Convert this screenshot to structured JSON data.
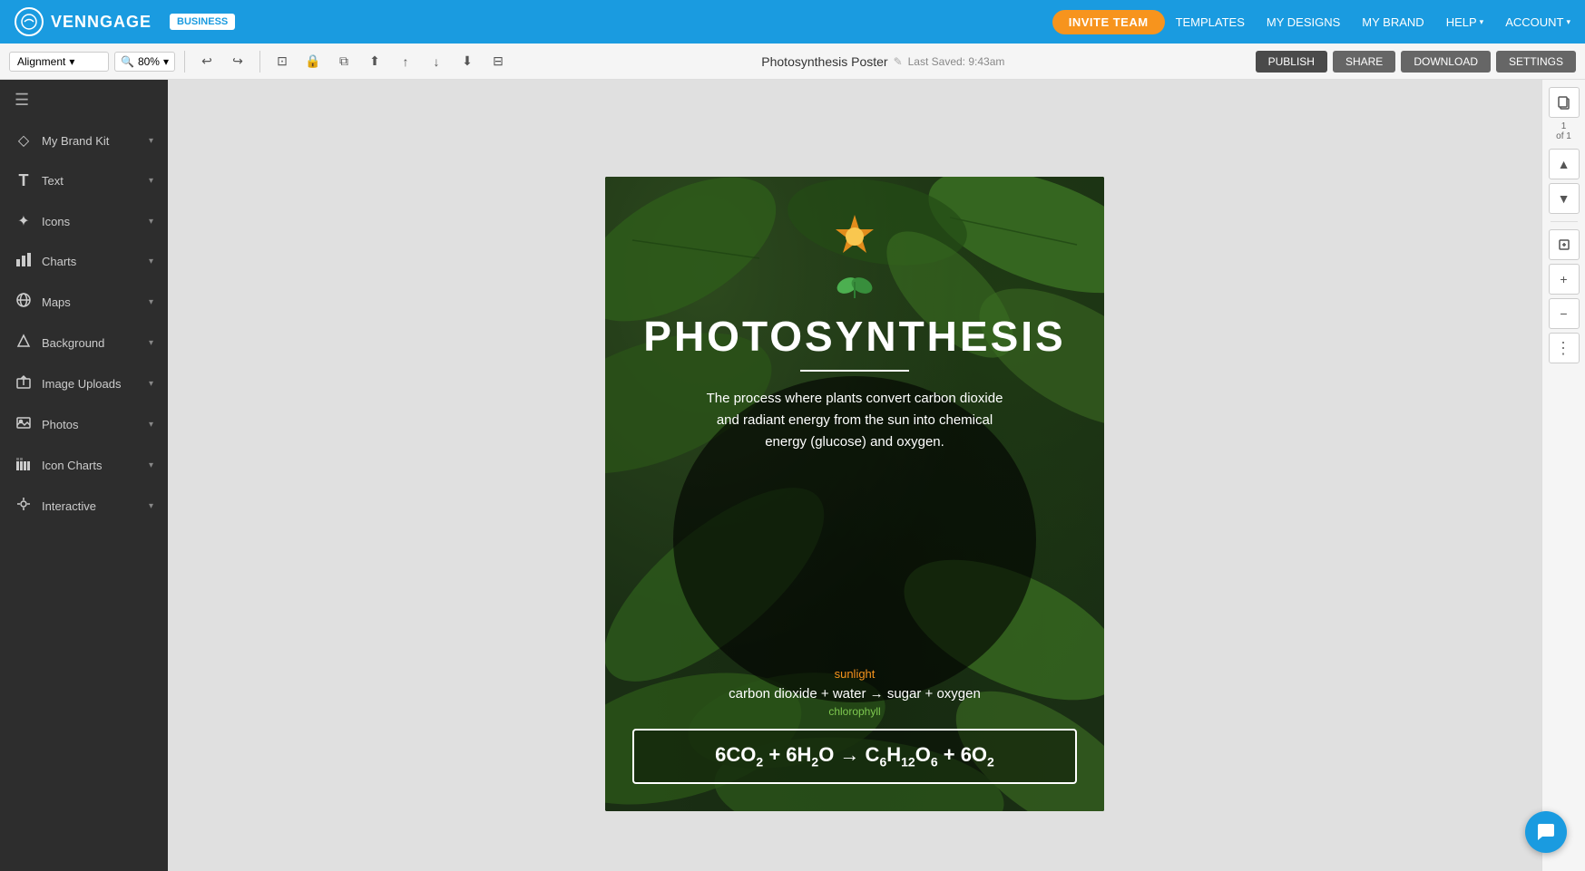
{
  "brand": "VENNGAGE",
  "badge": "BUSINESS",
  "nav": {
    "invite_btn": "INVITE TEAM",
    "links": [
      {
        "label": "TEMPLATES",
        "has_dropdown": false
      },
      {
        "label": "MY DESIGNS",
        "has_dropdown": false
      },
      {
        "label": "MY BRAND",
        "has_dropdown": false
      },
      {
        "label": "HELP",
        "has_dropdown": true
      },
      {
        "label": "ACCOUNT",
        "has_dropdown": true
      }
    ]
  },
  "toolbar": {
    "alignment_label": "Alignment",
    "zoom_label": "80%",
    "doc_title": "Photosynthesis Poster",
    "save_status": "Last Saved: 9:43am",
    "undo_icon": "↩",
    "redo_icon": "↪",
    "publish_label": "PUBLISH",
    "share_label": "SHARE",
    "download_label": "DOWNLOAD",
    "settings_label": "SETTINGS"
  },
  "sidebar": {
    "items": [
      {
        "label": "My Brand Kit",
        "icon": "◇"
      },
      {
        "label": "Text",
        "icon": "T"
      },
      {
        "label": "Icons",
        "icon": "❖"
      },
      {
        "label": "Charts",
        "icon": "📊"
      },
      {
        "label": "Maps",
        "icon": "🌐"
      },
      {
        "label": "Background",
        "icon": "□"
      },
      {
        "label": "Image Uploads",
        "icon": "⬆"
      },
      {
        "label": "Photos",
        "icon": "🖼"
      },
      {
        "label": "Icon Charts",
        "icon": "📈"
      },
      {
        "label": "Interactive",
        "icon": "⚡"
      }
    ]
  },
  "poster": {
    "sun_icon": "✦",
    "plant_icon": "🌿",
    "title": "PHOTOSYNTHESIS",
    "description": "The process where plants convert carbon dioxide and radiant energy from the sun into chemical energy (glucose) and oxygen.",
    "sunlight_label": "sunlight",
    "simple_equation": "carbon dioxide + water → sugar + oxygen",
    "chlorophyll_label": "chlorophyll",
    "equation": "6CO₂ + 6H₂O → C₆H₁₂O₆ + 6O₂"
  },
  "right_panel": {
    "page_num": "1",
    "page_total": "of 1"
  },
  "colors": {
    "nav_blue": "#1a9be0",
    "orange": "#f7941d",
    "green": "#4caf50",
    "dark_bg": "#2d2d2d"
  }
}
